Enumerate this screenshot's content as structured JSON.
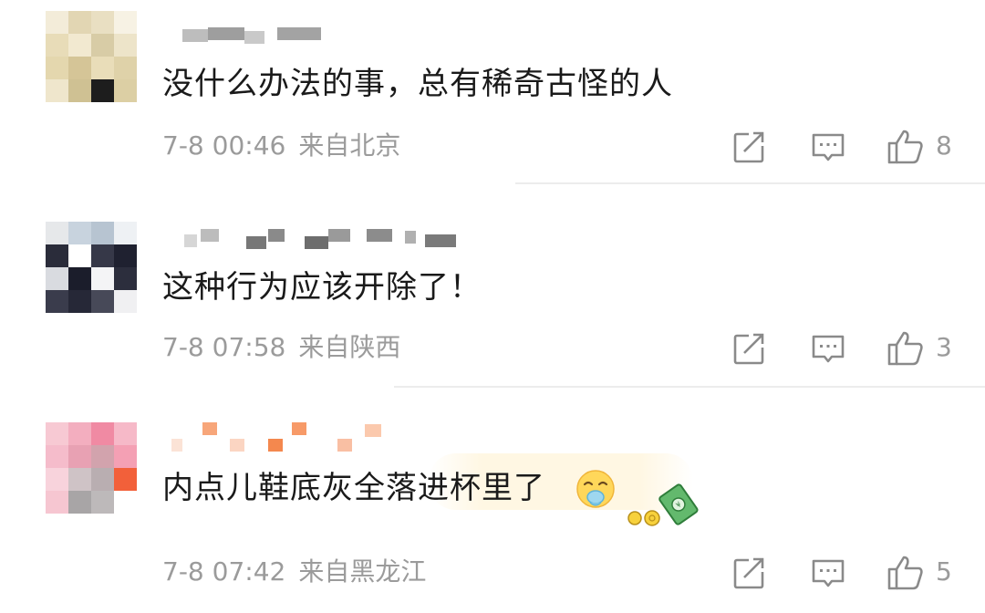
{
  "comments": [
    {
      "text": "没什么办法的事，总有稀奇古怪的人",
      "time": "7-8 00:46",
      "location": "来自北京",
      "likes": "8",
      "username_hidden": true
    },
    {
      "text": "这种行为应该开除了！",
      "time": "7-8 07:58",
      "location": "来自陕西",
      "likes": "3",
      "username_hidden": true
    },
    {
      "text": "内点儿鞋底灰全落进杯里了",
      "time": "7-8 07:42",
      "location": "来自黑龙江",
      "likes": "5",
      "username_hidden": true,
      "emoji": "vomiting-face-emoji",
      "sticker": "money-sticker"
    }
  ],
  "icons": {
    "share": "share-icon",
    "reply": "comment-icon",
    "like": "thumbs-up-icon"
  },
  "colors": {
    "text": "#1a1a1a",
    "meta": "#9b9b9b",
    "icon": "#8a8a8a",
    "divider": "#ececec"
  }
}
